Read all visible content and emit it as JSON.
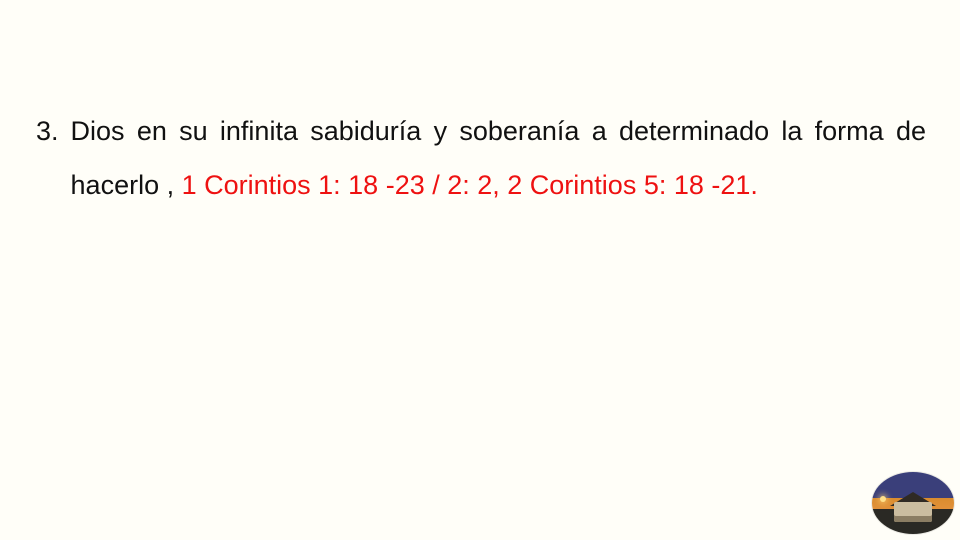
{
  "list": {
    "number": "3.",
    "segments": [
      {
        "text": "Dios en su infinita sabiduría y soberanía a determinado la forma de hacerlo , ",
        "ref": false
      },
      {
        "text": "1 Corintios 1: 18 -23 / 2: 2, 2 Corintios 5: 18 -21.",
        "ref": true
      }
    ]
  },
  "image": {
    "alt": "house-at-dusk"
  }
}
